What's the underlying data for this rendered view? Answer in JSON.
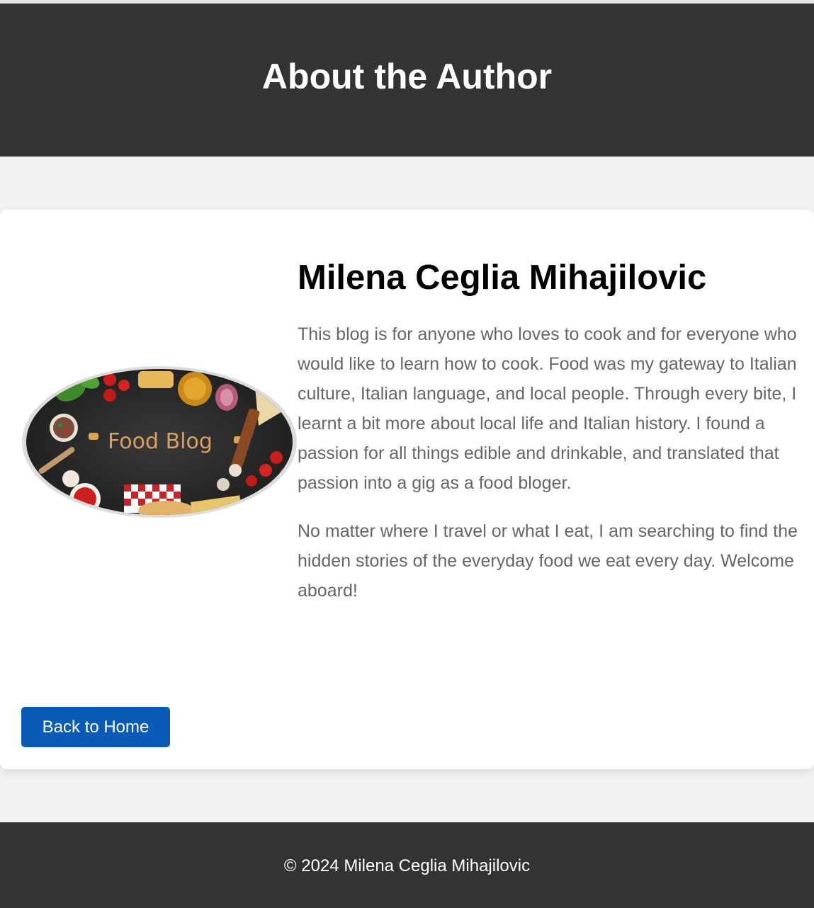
{
  "header": {
    "title": "About the Author"
  },
  "author": {
    "name": "Milena Ceglia Mihajilovic",
    "image_text": "Food Blog",
    "paragraphs": [
      "This blog is for anyone who loves to cook and for everyone who would like to learn how to cook. Food was my gateway to Italian culture, Italian language, and local people. Through every bite, I learnt a bit more about local life and Italian history. I found a passion for all things edible and drinkable, and translated that passion into a gig as a food bloger.",
      "No matter where I travel or what I eat, I am searching to find the hidden stories of the everyday food we eat every day. Welcome aboard!"
    ]
  },
  "actions": {
    "back_label": "Back to Home"
  },
  "footer": {
    "copyright": "© 2024 Milena Ceglia Mihajilovic"
  },
  "colors": {
    "header_bg": "#333333",
    "page_bg": "#f2f2f2",
    "button_bg": "#0a5bb5",
    "body_text": "#666666"
  }
}
